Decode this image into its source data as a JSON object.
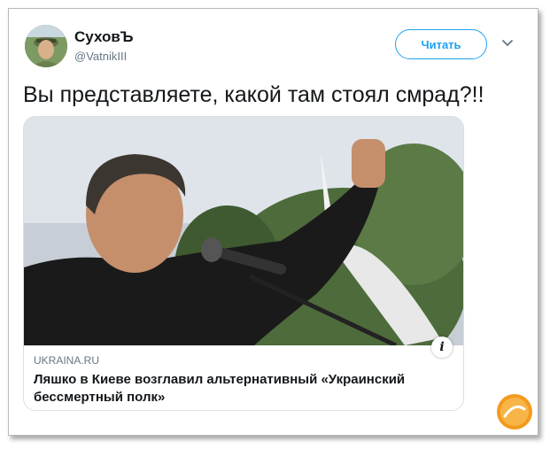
{
  "user": {
    "name": "СуховЪ",
    "handle": "@VatnikIII"
  },
  "follow_button": {
    "label": "Читать"
  },
  "tweet": {
    "text": "Вы представляете, какой там стоял смрад?!!"
  },
  "card": {
    "domain": "UKRAINA.RU",
    "title": "Ляшко в Киеве возглавил альтернативный «Украинский бессмертный полк»",
    "info_icon": "i"
  },
  "icons": {
    "menu": "chevron-down-icon",
    "logo": "watermark-logo"
  },
  "colors": {
    "accent": "#1da1f2",
    "text": "#14171a",
    "secondary": "#657786",
    "logo_orange": "#f39a1e"
  }
}
